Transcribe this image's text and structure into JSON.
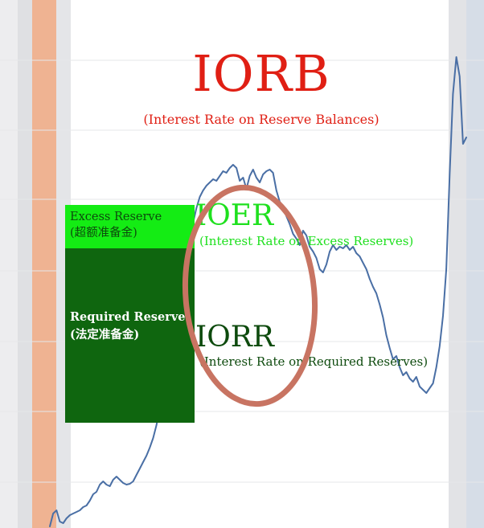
{
  "chart_data": {
    "type": "line",
    "title": "",
    "xlabel": "",
    "ylabel": "",
    "grid": true,
    "series": [
      {
        "values": [
          2,
          18,
          22,
          8,
          6,
          12,
          16,
          18,
          20,
          22,
          26,
          28,
          34,
          42,
          45,
          54,
          58,
          54,
          52,
          60,
          64,
          60,
          56,
          54,
          55,
          58,
          66,
          74,
          82,
          90,
          100,
          112,
          128,
          150,
          172,
          196,
          222,
          248,
          270,
          294,
          318,
          340,
          360,
          380,
          398,
          412,
          420,
          426,
          430,
          434,
          432,
          438,
          444,
          442,
          448,
          452,
          448,
          432,
          436,
          422,
          438,
          446,
          436,
          430,
          440,
          444,
          446,
          442,
          420,
          406,
          400,
          388,
          378,
          366,
          360,
          352,
          370,
          364,
          350,
          344,
          336,
          322,
          318,
          328,
          344,
          352,
          346,
          350,
          348,
          352,
          346,
          350,
          342,
          338,
          330,
          322,
          310,
          300,
          292,
          278,
          262,
          240,
          224,
          210,
          214,
          200,
          190,
          194,
          186,
          182,
          188,
          176,
          172,
          168,
          174,
          180,
          200,
          226,
          264,
          322,
          440,
          540,
          586,
          562,
          478,
          486
        ]
      }
    ]
  },
  "annotations": {
    "iorb": {
      "title": "IORB",
      "subtitle": "(Interest Rate on Reserve Balances)",
      "color": "#e01f14"
    },
    "ioer": {
      "title": "IOER",
      "subtitle": "(Interest Rate on Excess Reserves)",
      "color": "#1ee01e"
    },
    "iorr": {
      "title": "IORR",
      "subtitle": "(Interest Rate on Required Reserves)",
      "color": "#0d4a0d"
    }
  },
  "reserve_boxes": {
    "excess": {
      "line1": "Excess Reserve",
      "line2": "(超额准备金)",
      "color": "#14ec14"
    },
    "required": {
      "line1": "Required Reserve",
      "line2": "(法定准备金)",
      "color": "#0f660f"
    }
  },
  "colors": {
    "line": "#4a6fa5",
    "circle": "#c87462",
    "recession_band": "#efb392",
    "grid": "#e6e7ea"
  }
}
